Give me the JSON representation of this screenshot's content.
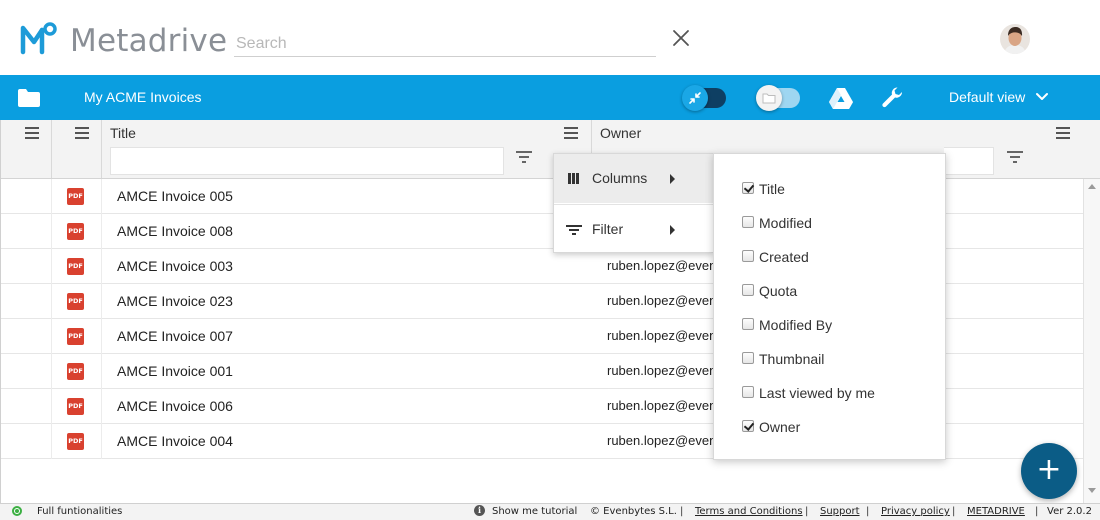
{
  "header": {
    "brand": "Metadrive",
    "search_placeholder": "Search"
  },
  "toolbar": {
    "title": "My ACME Invoices",
    "view_label": "Default view"
  },
  "grid": {
    "columns": [
      "Title",
      "Owner"
    ],
    "rows": [
      {
        "icon": "PDF",
        "title": "AMCE Invoice 005",
        "owner": ""
      },
      {
        "icon": "PDF",
        "title": "AMCE Invoice 008",
        "owner": ""
      },
      {
        "icon": "PDF",
        "title": "AMCE Invoice 003",
        "owner": "ruben.lopez@even"
      },
      {
        "icon": "PDF",
        "title": "AMCE Invoice 023",
        "owner": "ruben.lopez@even"
      },
      {
        "icon": "PDF",
        "title": "AMCE Invoice 007",
        "owner": "ruben.lopez@even"
      },
      {
        "icon": "PDF",
        "title": "AMCE Invoice 001",
        "owner": "ruben.lopez@even"
      },
      {
        "icon": "PDF",
        "title": "AMCE Invoice 006",
        "owner": "ruben.lopez@even"
      },
      {
        "icon": "PDF",
        "title": "AMCE Invoice 004",
        "owner": "ruben.lopez@even"
      }
    ]
  },
  "menu": {
    "columns_label": "Columns",
    "filter_label": "Filter"
  },
  "column_options": [
    {
      "label": "Title",
      "checked": true
    },
    {
      "label": "Modified",
      "checked": false
    },
    {
      "label": "Created",
      "checked": false
    },
    {
      "label": "Quota",
      "checked": false
    },
    {
      "label": "Modified By",
      "checked": false
    },
    {
      "label": "Thumbnail",
      "checked": false
    },
    {
      "label": "Last viewed by me",
      "checked": false
    },
    {
      "label": "Owner",
      "checked": true
    }
  ],
  "fab_label": "+",
  "footer": {
    "status": "Full funtionalities",
    "tutorial": "Show me tutorial",
    "copyright": "© Evenbytes S.L.",
    "terms": "Terms and Conditions",
    "support": "Support",
    "privacy": "Privacy policy",
    "brand_link": "METADRIVE",
    "version": "Ver 2.0.2",
    "separator": "|"
  },
  "colors": {
    "toolbar": "#0a9ee0",
    "fab": "#0b5c86",
    "pdf": "#d9412f",
    "status_ok": "#3cb043"
  }
}
